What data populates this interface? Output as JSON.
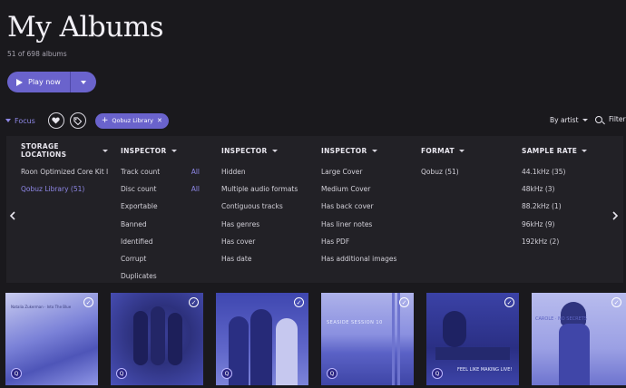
{
  "header": {
    "title": "My Albums",
    "subtitle": "51 of 698 albums",
    "play_label": "Play now"
  },
  "focus_bar": {
    "focus_label": "Focus",
    "chip_label": "Qobuz Library",
    "sort_label": "By artist",
    "filter_label": "Filter"
  },
  "columns": [
    {
      "heading": "STORAGE LOCATIONS",
      "items": [
        "Roon Optimized Core Kit Intr",
        "Qobuz Library (51)"
      ]
    },
    {
      "heading": "INSPECTOR",
      "items": [
        "Track count",
        "Disc count",
        "Exportable",
        "Banned",
        "Identified",
        "Corrupt",
        "Duplicates"
      ],
      "all_label": "All"
    },
    {
      "heading": "INSPECTOR",
      "items": [
        "Hidden",
        "Multiple audio formats",
        "Contiguous tracks",
        "Has genres",
        "Has cover",
        "Has date"
      ]
    },
    {
      "heading": "INSPECTOR",
      "items": [
        "Large Cover",
        "Medium Cover",
        "Has back cover",
        "Has liner notes",
        "Has PDF",
        "Has additional images"
      ]
    },
    {
      "heading": "FORMAT",
      "items": [
        "Qobuz (51)"
      ]
    },
    {
      "heading": "SAMPLE RATE",
      "items": [
        "44.1kHz (35)",
        "48kHz (3)",
        "88.2kHz (1)",
        "96kHz (9)",
        "192kHz (2)"
      ]
    }
  ],
  "albums": [
    {
      "cover_text": "Natalia Zukerman · Into The Blue",
      "check": "✓",
      "badge": "Q"
    },
    {
      "cover_text": "",
      "check": "✓",
      "badge": "Q"
    },
    {
      "cover_text": "",
      "check": "✓",
      "badge": "Q"
    },
    {
      "cover_text": "SEASIDE SESSION 10",
      "check": "✓",
      "badge": "Q"
    },
    {
      "cover_text": "FEEL LIKE MAKING LIVE!",
      "check": "✓",
      "badge": "Q"
    },
    {
      "cover_text": "CAROLE · NO SECRETS",
      "check": "✓",
      "badge": "Q"
    }
  ],
  "colors": {
    "accent": "#6a63cc",
    "accent_text": "#8e87e6",
    "background": "#1a191d",
    "panel": "#222126"
  }
}
